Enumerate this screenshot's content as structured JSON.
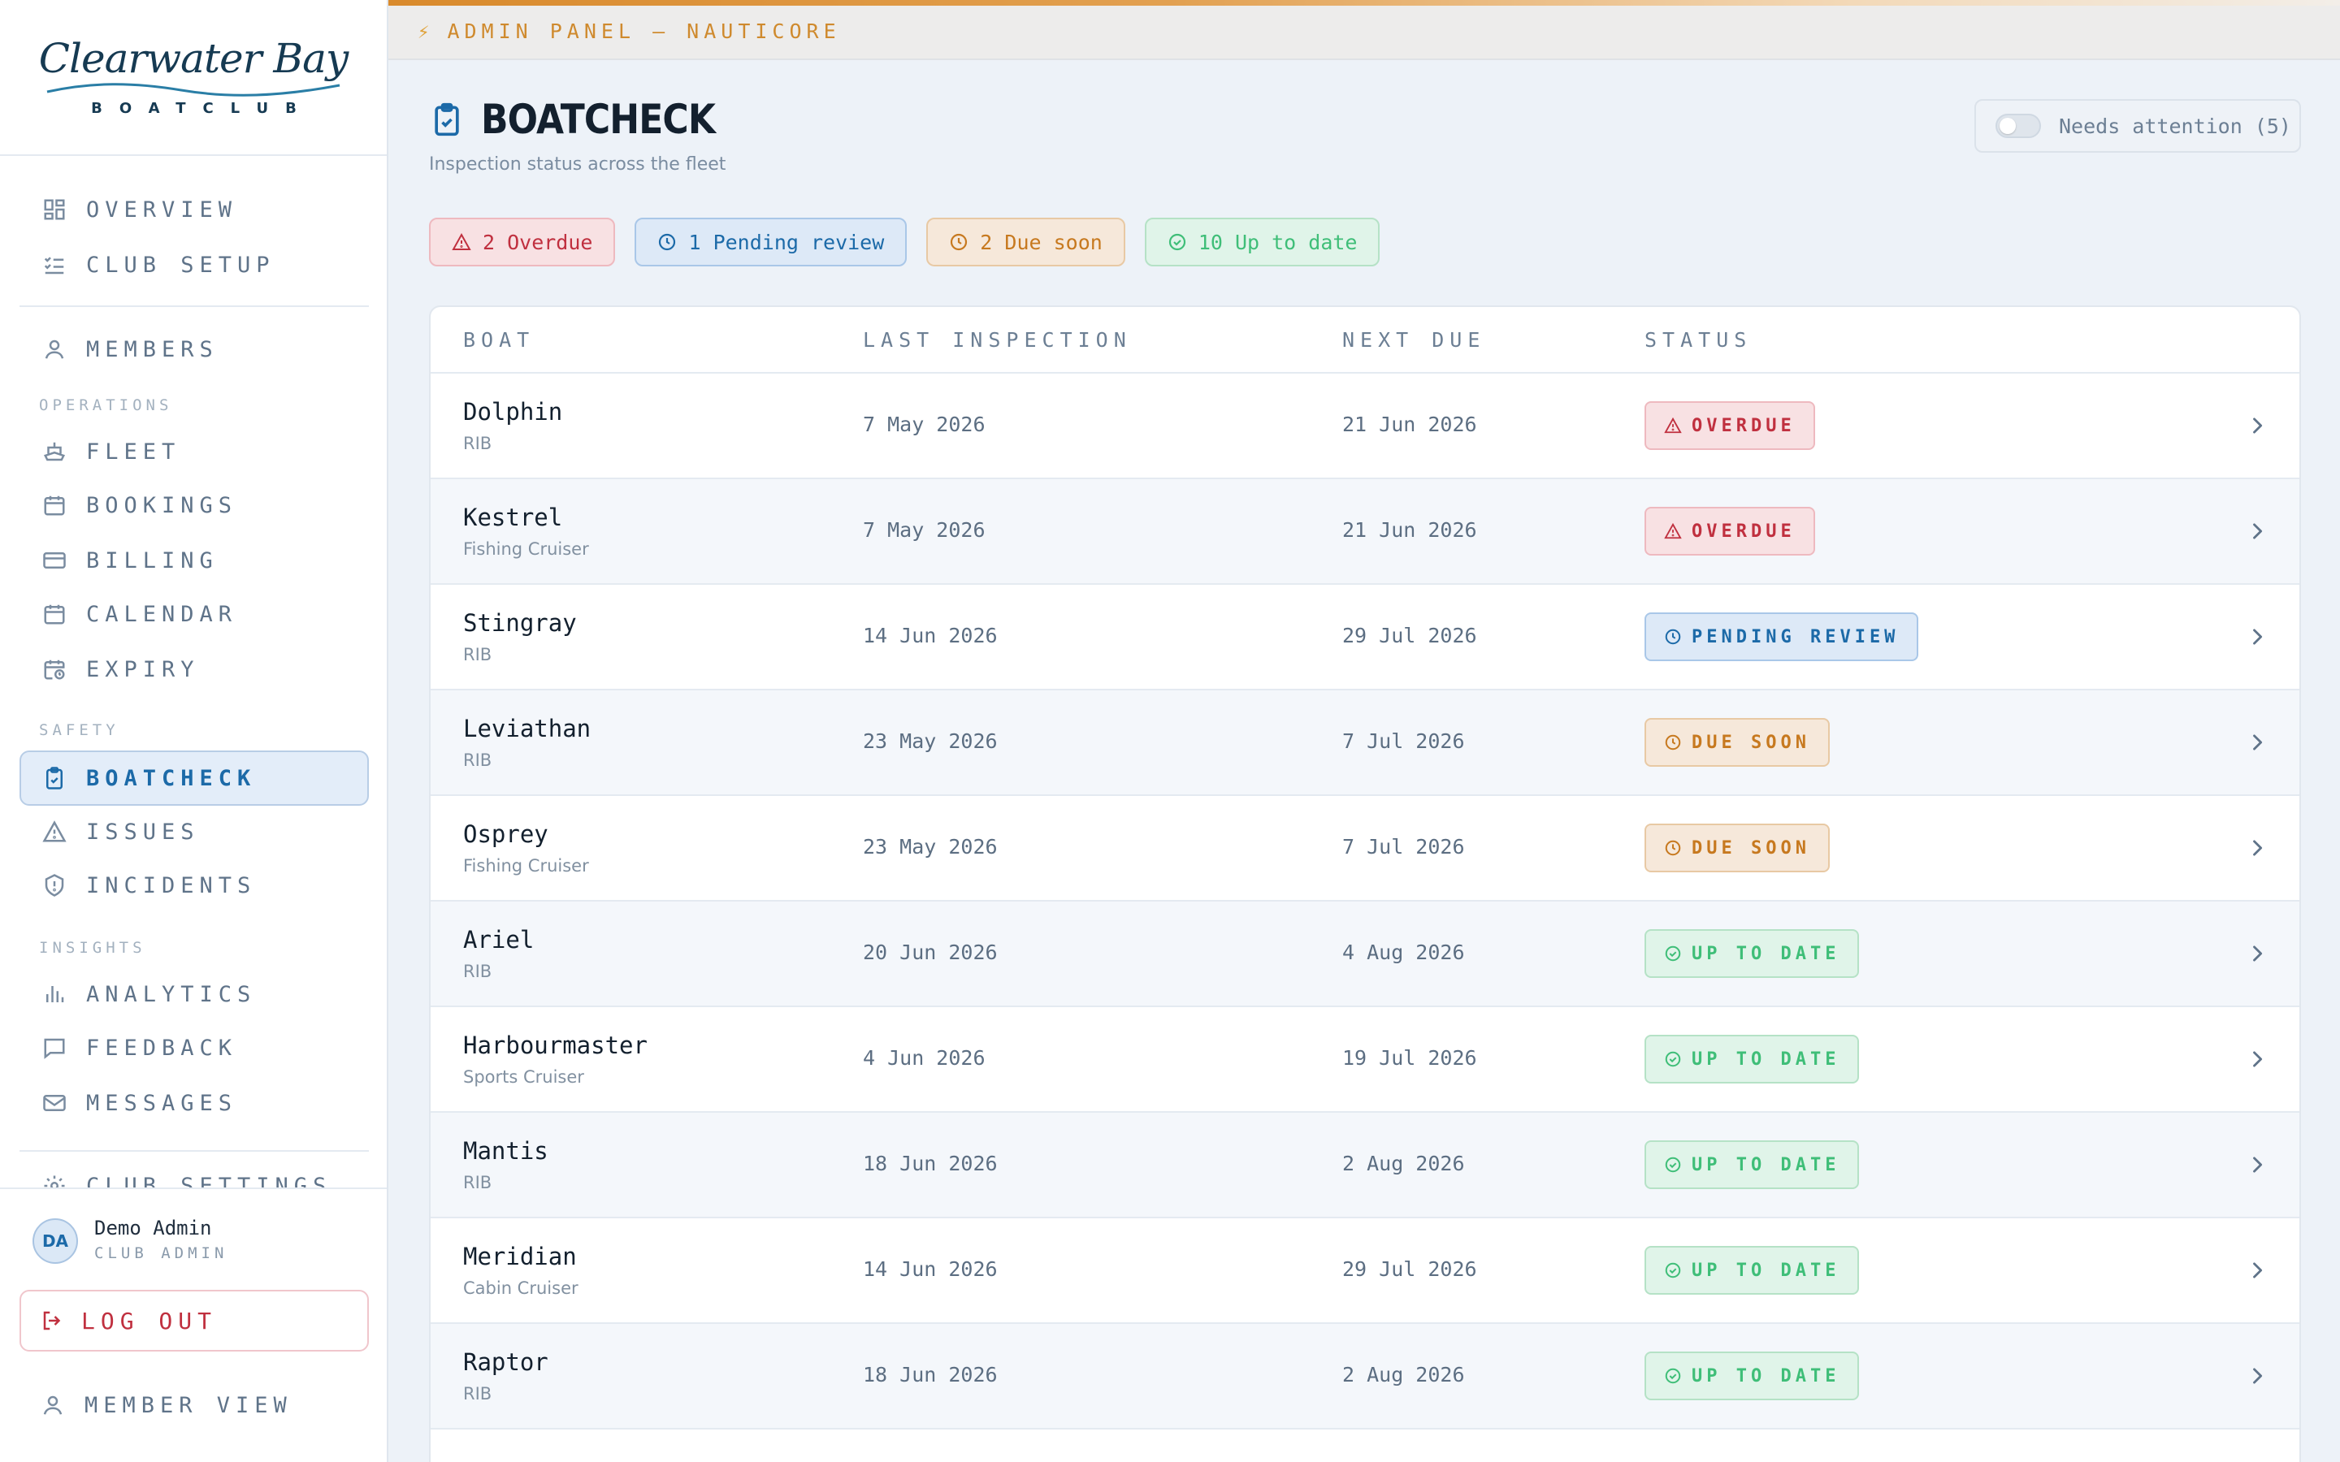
{
  "brand": {
    "name": "Clearwater Bay",
    "sub": "BOATCLUB"
  },
  "nav": {
    "overview": "OVERVIEW",
    "club_setup": "CLUB SETUP",
    "members": "MEMBERS",
    "section_operations": "OPERATIONS",
    "fleet": "FLEET",
    "bookings": "BOOKINGS",
    "billing": "BILLING",
    "calendar": "CALENDAR",
    "expiry": "EXPIRY",
    "section_safety": "SAFETY",
    "boatcheck": "BOATCHECK",
    "issues": "ISSUES",
    "incidents": "INCIDENTS",
    "section_insights": "INSIGHTS",
    "analytics": "ANALYTICS",
    "feedback": "FEEDBACK",
    "messages": "MESSAGES",
    "club_settings": "CLUB SETTINGS"
  },
  "user": {
    "initials": "DA",
    "name": "Demo Admin",
    "role": "CLUB ADMIN",
    "logout": "LOG OUT",
    "member_view": "MEMBER VIEW"
  },
  "banner": {
    "icon": "lightning-icon",
    "text": "ADMIN PANEL — NAUTICORE",
    "accent": "#d98a2c"
  },
  "page": {
    "title": "BOATCHECK",
    "subtitle": "Inspection status across the fleet"
  },
  "attention_toggle": {
    "label": "Needs attention (5)",
    "on": false
  },
  "summary": {
    "overdue": "2 Overdue",
    "pending": "1 Pending review",
    "due_soon": "2 Due soon",
    "up_to_date": "10 Up to date"
  },
  "table": {
    "headers": {
      "boat": "BOAT",
      "last": "LAST INSPECTION",
      "next": "NEXT DUE",
      "status": "STATUS"
    },
    "rows": [
      {
        "name": "Dolphin",
        "type": "RIB",
        "last": "7 May 2026",
        "next": "21 Jun 2026",
        "status": "OVERDUE"
      },
      {
        "name": "Kestrel",
        "type": "Fishing Cruiser",
        "last": "7 May 2026",
        "next": "21 Jun 2026",
        "status": "OVERDUE"
      },
      {
        "name": "Stingray",
        "type": "RIB",
        "last": "14 Jun 2026",
        "next": "29 Jul 2026",
        "status": "PENDING REVIEW"
      },
      {
        "name": "Leviathan",
        "type": "RIB",
        "last": "23 May 2026",
        "next": "7 Jul 2026",
        "status": "DUE SOON"
      },
      {
        "name": "Osprey",
        "type": "Fishing Cruiser",
        "last": "23 May 2026",
        "next": "7 Jul 2026",
        "status": "DUE SOON"
      },
      {
        "name": "Ariel",
        "type": "RIB",
        "last": "20 Jun 2026",
        "next": "4 Aug 2026",
        "status": "UP TO DATE"
      },
      {
        "name": "Harbourmaster",
        "type": "Sports Cruiser",
        "last": "4 Jun 2026",
        "next": "19 Jul 2026",
        "status": "UP TO DATE"
      },
      {
        "name": "Mantis",
        "type": "RIB",
        "last": "18 Jun 2026",
        "next": "2 Aug 2026",
        "status": "UP TO DATE"
      },
      {
        "name": "Meridian",
        "type": "Cabin Cruiser",
        "last": "14 Jun 2026",
        "next": "29 Jul 2026",
        "status": "UP TO DATE"
      },
      {
        "name": "Raptor",
        "type": "RIB",
        "last": "18 Jun 2026",
        "next": "2 Aug 2026",
        "status": "UP TO DATE"
      }
    ]
  },
  "colors": {
    "overdue": "#c0303f",
    "pending": "#1c6aa8",
    "due_soon": "#c7791f",
    "up_to_date": "#3fbe78"
  }
}
